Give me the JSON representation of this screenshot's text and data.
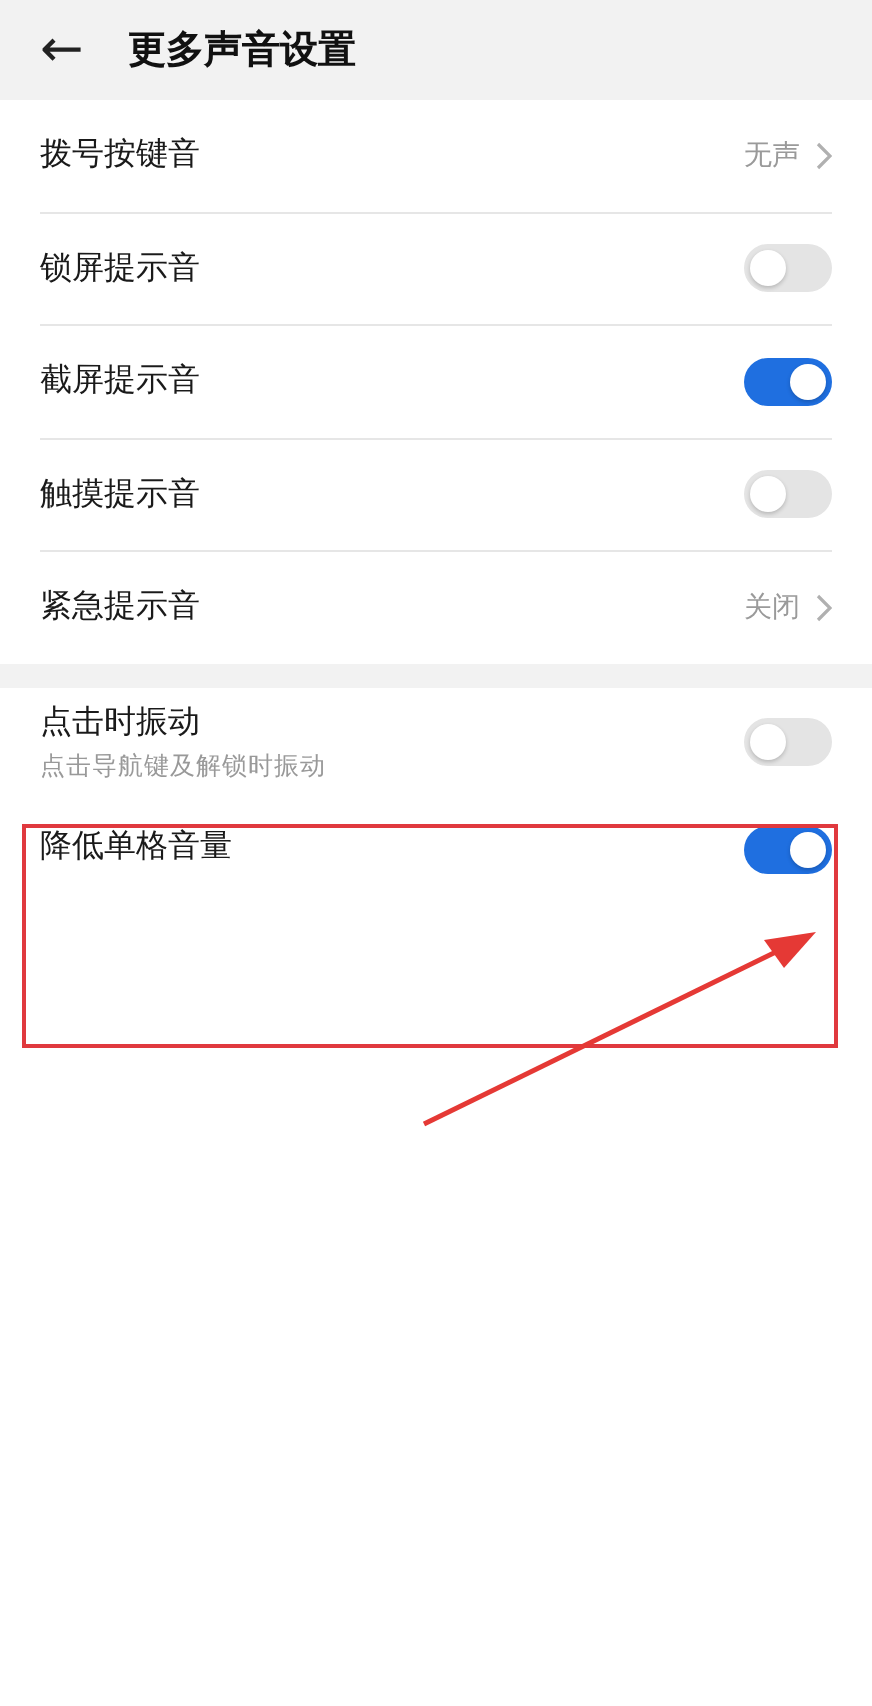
{
  "header": {
    "back": "←",
    "title": "更多声音设置"
  },
  "sections": [
    {
      "rows": [
        {
          "kind": "link",
          "label": "拨号按键音",
          "value": "无声"
        },
        {
          "kind": "toggle",
          "label": "锁屏提示音",
          "on": false
        },
        {
          "kind": "toggle",
          "label": "截屏提示音",
          "on": true
        },
        {
          "kind": "toggle",
          "label": "触摸提示音",
          "on": false
        },
        {
          "kind": "link",
          "label": "紧急提示音",
          "value": "关闭"
        }
      ]
    },
    {
      "rows": [
        {
          "kind": "toggle",
          "label": "点击时振动",
          "subtitle": "点击导航键及解锁时振动",
          "on": false
        },
        {
          "kind": "toggle",
          "label": "降低单格音量",
          "on": true,
          "tall": true
        }
      ]
    }
  ],
  "annotations": [
    {
      "kind": "highlight-box"
    },
    {
      "kind": "arrow"
    }
  ]
}
